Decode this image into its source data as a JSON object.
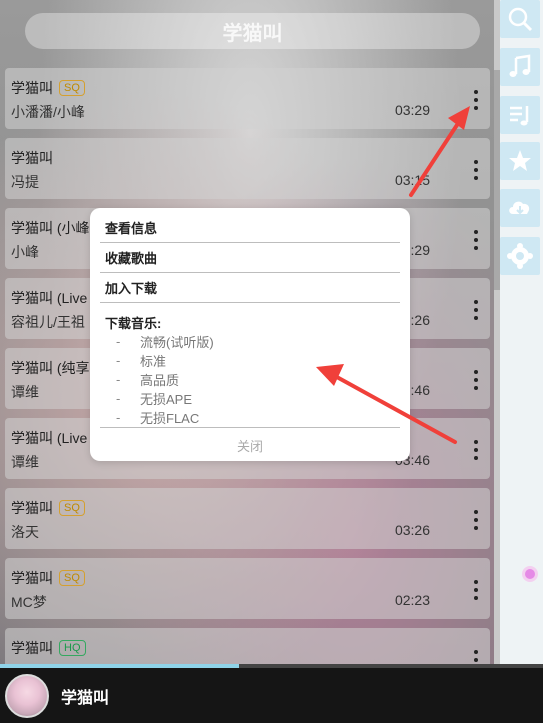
{
  "search": {
    "placeholder": "学猫叫"
  },
  "songs": [
    {
      "title": "学猫叫",
      "badge": "SQ",
      "artist": "小潘潘/小峰",
      "time": "03:29"
    },
    {
      "title": "学猫叫",
      "badge": "",
      "artist": "冯提",
      "time": "03:15"
    },
    {
      "title": "学猫叫 (小峰",
      "badge": "",
      "artist": "小峰",
      "time": "03:29"
    },
    {
      "title": "学猫叫 (Live",
      "badge": "",
      "artist": "容祖儿/王祖",
      "time": "03:26"
    },
    {
      "title": "学猫叫 (纯享",
      "badge": "",
      "artist": "谭维",
      "time": "03:46"
    },
    {
      "title": "学猫叫 (Live",
      "badge": "",
      "artist": "谭维",
      "time": "03:46"
    },
    {
      "title": "学猫叫",
      "badge": "SQ",
      "artist": "洛天",
      "time": "03:26"
    },
    {
      "title": "学猫叫",
      "badge": "SQ",
      "artist": "MC梦",
      "time": "02:23"
    },
    {
      "title": "学猫叫",
      "badge": "HQ",
      "artist": "",
      "time": ""
    }
  ],
  "popup": {
    "view_info": "查看信息",
    "favorite": "收藏歌曲",
    "add_download": "加入下载",
    "download_heading": "下载音乐:",
    "download_options": [
      "流畅(试听版)",
      "标准",
      "高品质",
      "无损APE",
      "无损FLAC"
    ],
    "dash": "-",
    "close": "关闭"
  },
  "player": {
    "now_playing": "学猫叫",
    "progress": 0.44
  },
  "rail": {
    "icons": [
      "search-icon",
      "music-note-icon",
      "playlist-icon",
      "star-icon",
      "cloud-download-icon",
      "settings-icon"
    ]
  },
  "colors": {
    "accent": "#8fd3e8",
    "arrow": "#f0403a",
    "sq_badge": "#c08a00",
    "hq_badge": "#1a9a4a"
  }
}
